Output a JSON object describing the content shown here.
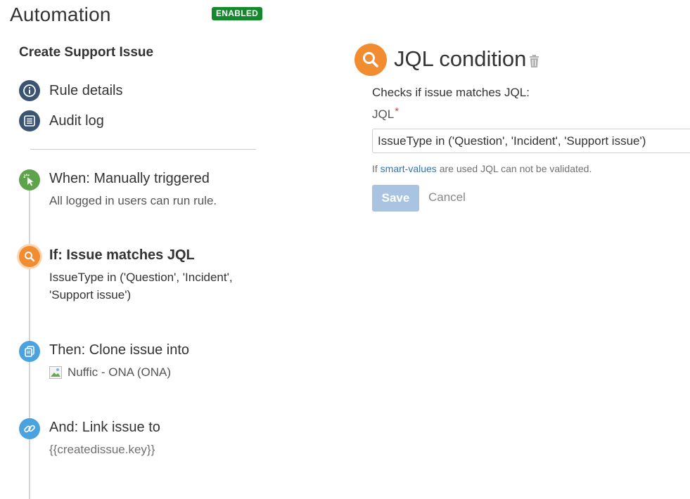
{
  "header": {
    "title": "Automation",
    "status_badge": "ENABLED"
  },
  "rule": {
    "name": "Create Support Issue"
  },
  "nav": [
    {
      "label": "Rule details",
      "icon": "info-icon"
    },
    {
      "label": "Audit log",
      "icon": "list-icon"
    }
  ],
  "steps": [
    {
      "title": "When: Manually triggered",
      "subtitle": "All logged in users can run rule.",
      "icon": "cursor-click-icon",
      "color": "#5ea34b"
    },
    {
      "title": "If: Issue matches JQL",
      "subtitle_line1": "IssueType in ('Question', 'Incident',",
      "subtitle_line2": "'Support issue')",
      "icon": "search-icon",
      "color": "#f28c30"
    },
    {
      "title": "Then: Clone issue into",
      "subtitle": "Nuffic - ONA (ONA)",
      "icon": "clone-icon",
      "color": "#4aa3df"
    },
    {
      "title": "And: Link issue to",
      "subtitle": "{{createdissue.key}}",
      "icon": "link-icon",
      "color": "#4aa3df"
    }
  ],
  "panel": {
    "title": "JQL condition",
    "description": "Checks if issue matches JQL:",
    "field_label": "JQL",
    "required_marker": "*",
    "field_value": "IssueType in ('Question', 'Incident', 'Support issue')",
    "help_prefix": "If",
    "help_link": "smart-values",
    "help_suffix": "are used JQL can not be validated.",
    "save_label": "Save",
    "cancel_label": "Cancel"
  },
  "colors": {
    "badge": "#14892c",
    "nav_icon": "#3b5472",
    "accent_orange": "#f28c30",
    "save_disabled": "#a8c4e0",
    "link": "#3572b0"
  }
}
